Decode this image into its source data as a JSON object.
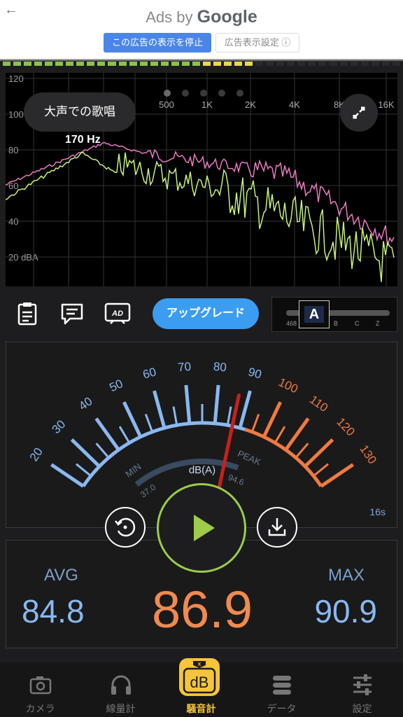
{
  "ad": {
    "title_prefix": "Ads by",
    "title_brand": "Google",
    "stop_button": "この広告の表示を停止",
    "settings_button": "広告表示設定 ⓘ"
  },
  "spectrum": {
    "mode_label": "大声での歌唱",
    "peak_freq": "170 Hz",
    "y_ticks": [
      "120",
      "100",
      "80",
      "60",
      "40",
      "20 dBA"
    ],
    "x_ticks": [
      "500",
      "1K",
      "2K",
      "4K",
      "8K",
      "16K"
    ]
  },
  "toolbar": {
    "upgrade": "アップグレード",
    "weighting_selected": "A",
    "weighting_options": [
      "468",
      "B",
      "C",
      "Z"
    ]
  },
  "meter": {
    "scale": [
      20,
      30,
      40,
      50,
      60,
      70,
      80,
      90,
      100,
      110,
      120,
      130
    ],
    "unit": "dB(A)",
    "min_label": "MIN",
    "min_value": "37.0",
    "peak_label": "PEAK",
    "peak_value": "94.6",
    "timer": "16s",
    "needle_value": 86.9
  },
  "stats": {
    "avg_label": "AVG",
    "avg_value": "84.8",
    "current_value": "86.9",
    "max_label": "MAX",
    "max_value": "90.9"
  },
  "nav": {
    "items": [
      "カメラ",
      "線量計",
      "騒音計",
      "データ",
      "設定"
    ],
    "active_icon_text": "dB"
  },
  "colors": {
    "accent": "#f5c53a",
    "blue": "#8ab8f0",
    "orange": "#f08a50",
    "green": "#9ccc4a",
    "pink": "#e87ac0",
    "needle": "#c8201a"
  }
}
